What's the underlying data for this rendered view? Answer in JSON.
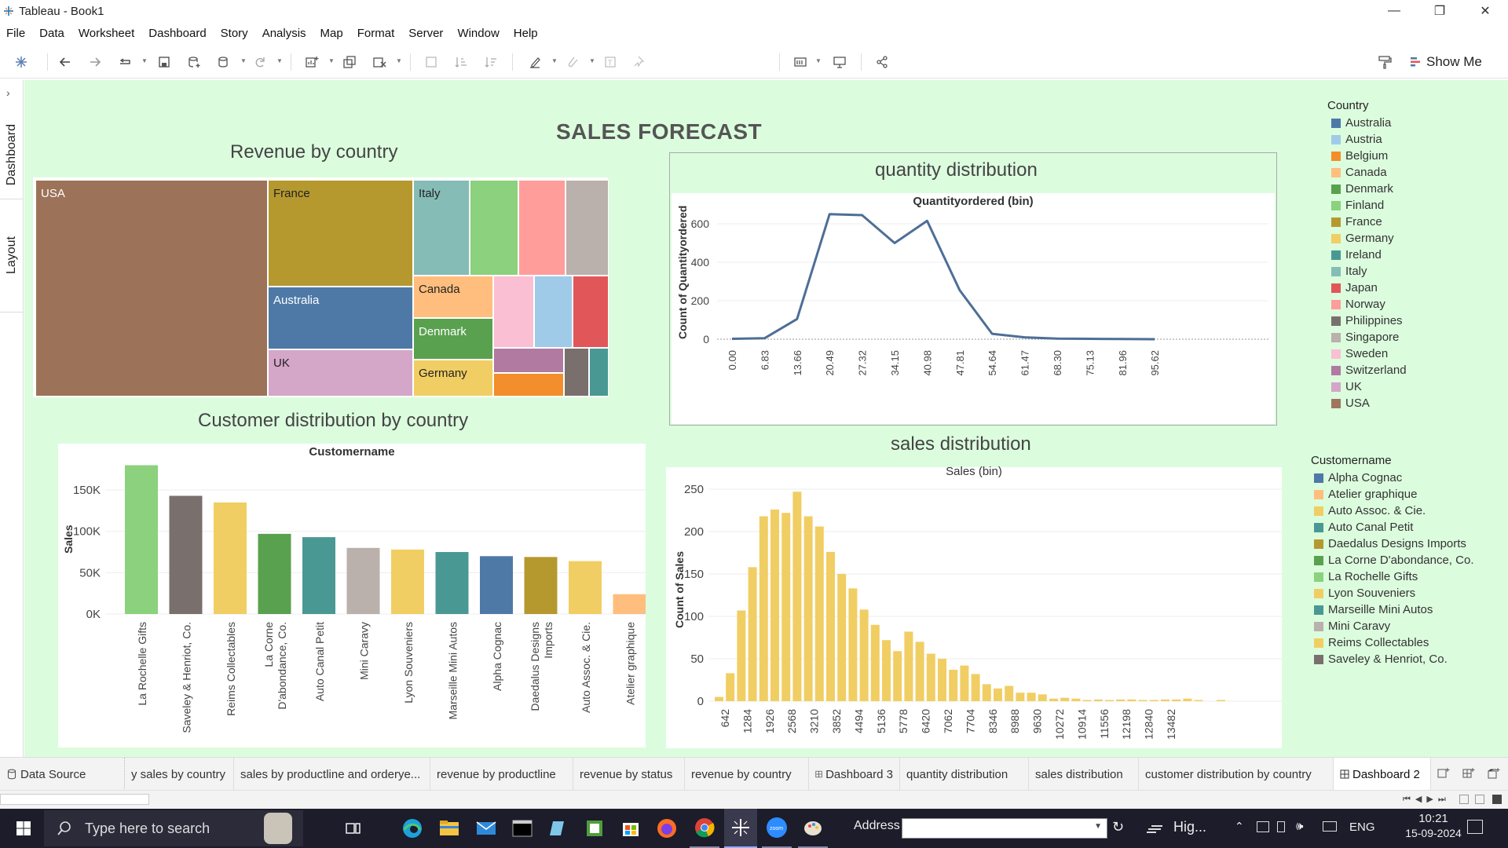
{
  "window": {
    "title": "Tableau - Book1",
    "minimize": "—",
    "maximize": "❐",
    "close": "✕"
  },
  "menu": [
    "File",
    "Data",
    "Worksheet",
    "Dashboard",
    "Story",
    "Analysis",
    "Map",
    "Format",
    "Server",
    "Window",
    "Help"
  ],
  "toolbar": {
    "show_me": "Show Me"
  },
  "side_tabs": {
    "dashboard": "Dashboard",
    "layout": "Layout"
  },
  "dashboard": {
    "title": "SALES FORECAST"
  },
  "revenue_by_country": {
    "title": "Revenue by country",
    "tiles": [
      {
        "label": "USA",
        "color": "#9c7259"
      },
      {
        "label": "France",
        "color": "#b5992f"
      },
      {
        "label": "Australia",
        "color": "#4e79a7"
      },
      {
        "label": "UK",
        "color": "#d4a6c8"
      },
      {
        "label": "Italy",
        "color": "#86bcb6"
      },
      {
        "label": "",
        "color": "#8cd17d"
      },
      {
        "label": "",
        "color": "#ff9d9a"
      },
      {
        "label": "",
        "color": "#bab0ac"
      },
      {
        "label": "Canada",
        "color": "#ffbe7d"
      },
      {
        "label": "",
        "color": "#fabfd2"
      },
      {
        "label": "",
        "color": "#a0cbe8"
      },
      {
        "label": "",
        "color": "#e15759"
      },
      {
        "label": "Denmark",
        "color": "#59a14f"
      },
      {
        "label": "Germany",
        "color": "#f1ce63"
      },
      {
        "label": "",
        "color": "#b07aa1"
      },
      {
        "label": "",
        "color": "#f28e2b"
      },
      {
        "label": "",
        "color": "#79706e"
      },
      {
        "label": "",
        "color": "#499894"
      }
    ]
  },
  "quantity_distribution": {
    "title": "quantity distribution",
    "subtitle": "Quantityordered (bin)"
  },
  "sales_distribution": {
    "title": "sales distribution",
    "subtitle": "Sales (bin)"
  },
  "customer_distribution": {
    "title": "Customer distribution by country",
    "subtitle": "Customername"
  },
  "chart_data": [
    {
      "id": "quantity",
      "type": "line",
      "x": [
        "0.00",
        "6.83",
        "13.66",
        "20.49",
        "27.32",
        "34.15",
        "40.98",
        "47.81",
        "54.64",
        "61.47",
        "68.30",
        "75.13",
        "81.96",
        "95.62"
      ],
      "values": [
        2,
        5,
        105,
        650,
        645,
        500,
        615,
        255,
        28,
        10,
        3,
        2,
        1,
        0
      ],
      "ylabel": "Count of Quantityordered",
      "ylim": [
        0,
        700
      ],
      "yticks": [
        0,
        200,
        400,
        600
      ],
      "color": "#4e6e96"
    },
    {
      "id": "sales",
      "type": "bar",
      "tick_labels": [
        "642",
        "1284",
        "1926",
        "2568",
        "3210",
        "3852",
        "4494",
        "5136",
        "5778",
        "6420",
        "7062",
        "7704",
        "8346",
        "8988",
        "9630",
        "10272",
        "10914",
        "11556",
        "12198",
        "12840",
        "13482"
      ],
      "values": [
        5,
        33,
        107,
        158,
        218,
        226,
        222,
        247,
        218,
        206,
        176,
        150,
        133,
        108,
        90,
        72,
        59,
        82,
        70,
        56,
        50,
        37,
        42,
        32,
        20,
        15,
        18,
        10,
        10,
        8,
        3,
        4,
        3,
        1,
        2,
        1,
        2,
        2,
        1,
        1,
        2,
        2,
        3,
        1,
        0,
        1,
        0,
        0,
        0,
        0,
        0,
        0,
        0,
        1
      ],
      "ylabel": "Count of Sales",
      "ylim": [
        0,
        260
      ],
      "yticks": [
        0,
        50,
        100,
        150,
        200,
        250
      ],
      "color": "#f1ce63"
    },
    {
      "id": "customers",
      "type": "bar",
      "categories": [
        "La Rochelle Gifts",
        "Saveley & Henriot, Co.",
        "Reims Collectables",
        "La Corne D'abondance, Co.",
        "Auto Canal Petit",
        "Mini Caravy",
        "Lyon Souveniers",
        "Marseille Mini Autos",
        "Alpha Cognac",
        "Daedalus Designs Imports",
        "Auto Assoc. & Cie.",
        "Atelier graphique"
      ],
      "label_lines": [
        [
          "La Rochelle Gifts"
        ],
        [
          "Saveley & Henriot, Co."
        ],
        [
          "Reims Collectables"
        ],
        [
          "La Corne",
          "D'abondance, Co."
        ],
        [
          "Auto Canal Petit"
        ],
        [
          "Mini Caravy"
        ],
        [
          "Lyon Souveniers"
        ],
        [
          "Marseille Mini Autos"
        ],
        [
          "Alpha Cognac"
        ],
        [
          "Daedalus Designs",
          "Imports"
        ],
        [
          "Auto Assoc. & Cie."
        ],
        [
          "Atelier graphique"
        ]
      ],
      "values": [
        180000,
        143000,
        135000,
        97000,
        93000,
        80000,
        78000,
        75000,
        70000,
        69000,
        64000,
        24000
      ],
      "colors": [
        "#8cd17d",
        "#79706e",
        "#f1ce63",
        "#59a14f",
        "#499894",
        "#bab0ac",
        "#f1ce63",
        "#499894",
        "#4e79a7",
        "#b5992f",
        "#f1ce63",
        "#ffbe7d"
      ],
      "ylabel": "Sales",
      "ylim": [
        0,
        190000
      ],
      "yticks": [
        0,
        50000,
        100000,
        150000
      ],
      "ytick_labels": [
        "0K",
        "50K",
        "100K",
        "150K"
      ]
    }
  ],
  "legend_country": {
    "title": "Country",
    "items": [
      {
        "label": "Australia",
        "color": "#4e79a7"
      },
      {
        "label": "Austria",
        "color": "#a0cbe8"
      },
      {
        "label": "Belgium",
        "color": "#f28e2b"
      },
      {
        "label": "Canada",
        "color": "#ffbe7d"
      },
      {
        "label": "Denmark",
        "color": "#59a14f"
      },
      {
        "label": "Finland",
        "color": "#8cd17d"
      },
      {
        "label": "France",
        "color": "#b6992d"
      },
      {
        "label": "Germany",
        "color": "#f1ce63"
      },
      {
        "label": "Ireland",
        "color": "#499894"
      },
      {
        "label": "Italy",
        "color": "#86bcb6"
      },
      {
        "label": "Japan",
        "color": "#e15759"
      },
      {
        "label": "Norway",
        "color": "#ff9d9a"
      },
      {
        "label": "Philippines",
        "color": "#79706e"
      },
      {
        "label": "Singapore",
        "color": "#bab0ac"
      },
      {
        "label": "Sweden",
        "color": "#fabfd2"
      },
      {
        "label": "Switzerland",
        "color": "#b07aa1"
      },
      {
        "label": "UK",
        "color": "#d4a6c8"
      },
      {
        "label": "USA",
        "color": "#9d7660"
      }
    ]
  },
  "legend_customer": {
    "title": "Customername",
    "items": [
      {
        "label": "Alpha Cognac",
        "color": "#4e79a7"
      },
      {
        "label": "Atelier graphique",
        "color": "#ffbe7d"
      },
      {
        "label": "Auto Assoc. & Cie.",
        "color": "#f1ce63"
      },
      {
        "label": "Auto Canal Petit",
        "color": "#499894"
      },
      {
        "label": "Daedalus Designs Imports",
        "color": "#b6992d"
      },
      {
        "label": "La Corne D'abondance, Co.",
        "color": "#59a14f"
      },
      {
        "label": "La Rochelle Gifts",
        "color": "#8cd17d"
      },
      {
        "label": "Lyon Souveniers",
        "color": "#f1ce63"
      },
      {
        "label": "Marseille Mini Autos",
        "color": "#499894"
      },
      {
        "label": "Mini Caravy",
        "color": "#bab0ac"
      },
      {
        "label": "Reims Collectables",
        "color": "#f1ce63"
      },
      {
        "label": "Saveley & Henriot, Co.",
        "color": "#79706e"
      }
    ]
  },
  "sheet_tabs": {
    "data_source": "Data Source",
    "tabs": [
      "y sales by country",
      "sales by productline and orderye...",
      "revenue by productline",
      "revenue by status",
      "revenue by country",
      "Dashboard 3",
      "quantity distribution",
      "sales distribution",
      "customer distribution by country",
      "Dashboard 2"
    ],
    "active": "Dashboard 2"
  },
  "taskbar": {
    "search_placeholder": "Type here to search",
    "address_label": "Address",
    "weather": "Hig...",
    "language": "ENG",
    "time": "10:21",
    "date": "15-09-2024"
  }
}
